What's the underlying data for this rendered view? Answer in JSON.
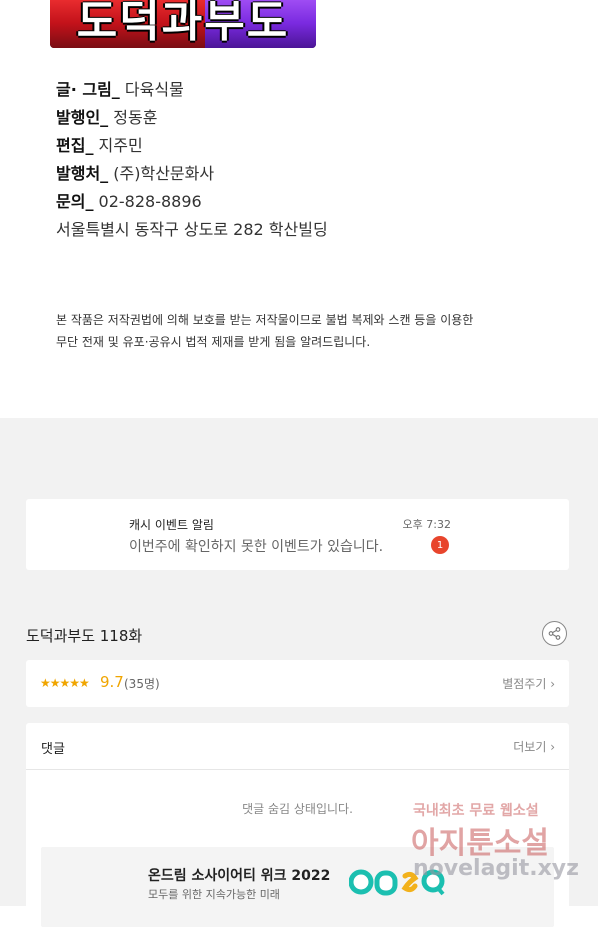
{
  "logo": {
    "text": "도덕과부도"
  },
  "credits": [
    {
      "label": "글· 그림_",
      "value": "다육식물"
    },
    {
      "label": "발행인_",
      "value": "정동훈"
    },
    {
      "label": "편집_",
      "value": "지주민"
    },
    {
      "label": "발행처_",
      "value": "(주)학산문화사"
    },
    {
      "label": "문의_",
      "value": "02-828-8896"
    },
    {
      "label": "",
      "value": "서울특별시 동작구 상도로 282 학산빌딩"
    }
  ],
  "notice": {
    "line1": "본 작품은 저작권법에 의해 보호를 받는 저작물이므로 불법 복제와 스캔 등을 이용한",
    "line2": "무단 전재 및 유포·공유시 법적 제재를 받게 됨을 알려드립니다."
  },
  "notification": {
    "title": "캐시 이벤트 알림",
    "time": "오후 7:32",
    "message": "이번주에 확인하지 못한 이벤트가 있습니다.",
    "badge": "1"
  },
  "episode": {
    "title": "도덕과부도 118화"
  },
  "rating": {
    "stars": "★★★★★",
    "score": "9.7",
    "count": "(35명)",
    "rate_label": "별점주기 ›"
  },
  "comments": {
    "header": "댓글",
    "more_label": "더보기 ›",
    "hidden_message": "댓글 숨김 상태입니다."
  },
  "ad": {
    "title": "온드림 소사이어티 위크 2022",
    "subtitle": "모두를 위한 지속가능한 미래",
    "brand": "onsQ"
  },
  "watermark": {
    "line1": "국내최초 무료 웹소설",
    "line2": "아지툰소설",
    "line3": "novelagit.xyz"
  },
  "colors": {
    "accent_star": "#f0a500",
    "badge": "#e8452c",
    "background_grey": "#f2f2f2"
  },
  "icons": {
    "share": "share-icon"
  }
}
